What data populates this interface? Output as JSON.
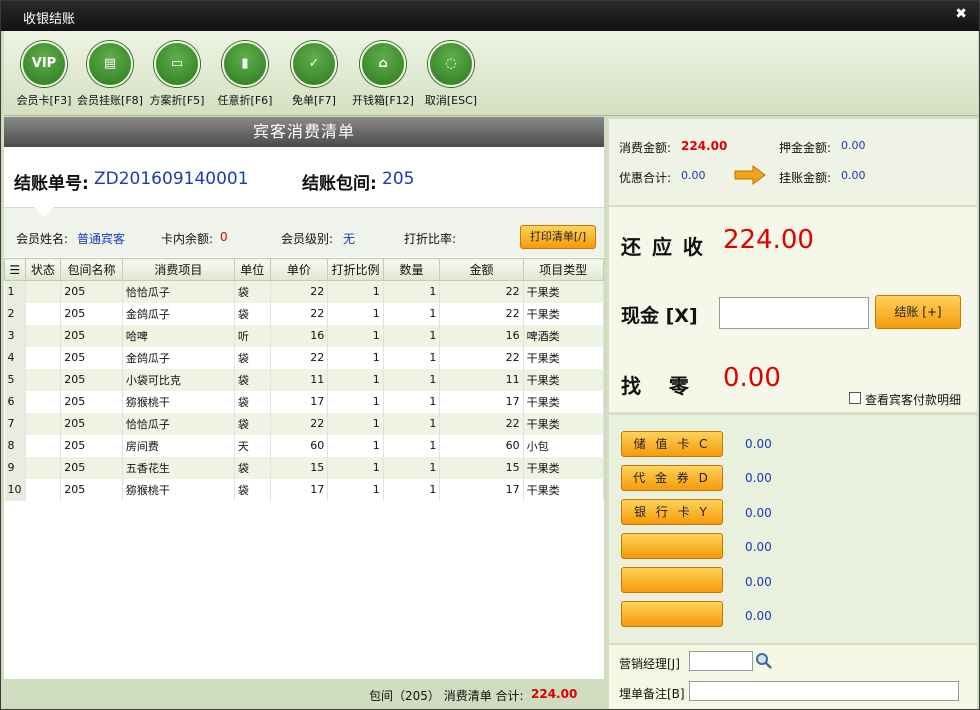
{
  "window": {
    "title": "收银结账",
    "close_glyph": "✖"
  },
  "toolbar": [
    {
      "label": "会员卡[F3]",
      "icon": "vip-icon",
      "glyph": "VIP"
    },
    {
      "label": "会员挂账[F8]",
      "icon": "bill-icon",
      "glyph": "▤"
    },
    {
      "label": "方案折[F5]",
      "icon": "plan-icon",
      "glyph": "▭"
    },
    {
      "label": "任意折[F6]",
      "icon": "discount-icon",
      "glyph": "▮"
    },
    {
      "label": "免单[F7]",
      "icon": "clipboard-check-icon",
      "glyph": "✓"
    },
    {
      "label": "开钱箱[F12]",
      "icon": "cashbox-icon",
      "glyph": "⌂"
    },
    {
      "label": "取消[ESC]",
      "icon": "cancel-icon",
      "glyph": "◌"
    }
  ],
  "list": {
    "title": "宾客消费清单",
    "order_no_label": "结账单号:",
    "order_no": "ZD201609140001",
    "room_label": "结账包间:",
    "room": "205"
  },
  "member": {
    "name_label": "会员姓名:",
    "name": "普通宾客",
    "balance_label": "卡内余额:",
    "balance": "0",
    "level_label": "会员级别:",
    "level": "无",
    "rate_label": "打折比率:",
    "rate": "",
    "print_button": "打印清单[/]"
  },
  "table": {
    "columns": [
      "状态",
      "包间名称",
      "消费项目",
      "单位",
      "单价",
      "打折比例",
      "数量",
      "金额",
      "项目类型"
    ],
    "rows": [
      {
        "idx": "1",
        "status": "",
        "room": "205",
        "item": "恰恰瓜子",
        "unit": "袋",
        "price": "22",
        "discount": "1",
        "qty": "1",
        "amount": "22",
        "type": "干果类"
      },
      {
        "idx": "2",
        "status": "",
        "room": "205",
        "item": "金鸽瓜子",
        "unit": "袋",
        "price": "22",
        "discount": "1",
        "qty": "1",
        "amount": "22",
        "type": "干果类"
      },
      {
        "idx": "3",
        "status": "",
        "room": "205",
        "item": "哈啤",
        "unit": "听",
        "price": "16",
        "discount": "1",
        "qty": "1",
        "amount": "16",
        "type": "啤酒类"
      },
      {
        "idx": "4",
        "status": "",
        "room": "205",
        "item": "金鸽瓜子",
        "unit": "袋",
        "price": "22",
        "discount": "1",
        "qty": "1",
        "amount": "22",
        "type": "干果类"
      },
      {
        "idx": "5",
        "status": "",
        "room": "205",
        "item": "小袋可比克",
        "unit": "袋",
        "price": "11",
        "discount": "1",
        "qty": "1",
        "amount": "11",
        "type": "干果类"
      },
      {
        "idx": "6",
        "status": "",
        "room": "205",
        "item": "猕猴桃干",
        "unit": "袋",
        "price": "17",
        "discount": "1",
        "qty": "1",
        "amount": "17",
        "type": "干果类"
      },
      {
        "idx": "7",
        "status": "",
        "room": "205",
        "item": "恰恰瓜子",
        "unit": "袋",
        "price": "22",
        "discount": "1",
        "qty": "1",
        "amount": "22",
        "type": "干果类"
      },
      {
        "idx": "8",
        "status": "",
        "room": "205",
        "item": "房间费",
        "unit": "天",
        "price": "60",
        "discount": "1",
        "qty": "1",
        "amount": "60",
        "type": "小包"
      },
      {
        "idx": "9",
        "status": "",
        "room": "205",
        "item": "五香花生",
        "unit": "袋",
        "price": "15",
        "discount": "1",
        "qty": "1",
        "amount": "15",
        "type": "干果类"
      },
      {
        "idx": "10",
        "status": "",
        "room": "205",
        "item": "猕猴桃干",
        "unit": "袋",
        "price": "17",
        "discount": "1",
        "qty": "1",
        "amount": "17",
        "type": "干果类"
      }
    ]
  },
  "footer": {
    "text": "包间（205） 消费清单 合计:",
    "total": "224.00"
  },
  "summary": {
    "consume_label": "消费金额:",
    "consume": "224.00",
    "deposit_label": "押金金额:",
    "deposit": "0.00",
    "discount_label": "优惠合计:",
    "discount": "0.00",
    "credit_label": "挂账金额:",
    "credit": "0.00"
  },
  "payment": {
    "due_label": "还 应 收",
    "due": "224.00",
    "cash_label": "现金 [X]",
    "cash_value": "",
    "checkout_button": "结账 [+]",
    "change_label": "找    零",
    "change": "0.00",
    "detail_checkbox": "查看宾客付款明细",
    "detail_checked": false
  },
  "methods": [
    {
      "label": "储 值 卡 C",
      "value": "0.00"
    },
    {
      "label": "代 金 券 D",
      "value": "0.00"
    },
    {
      "label": "银 行 卡 Y",
      "value": "0.00"
    },
    {
      "label": "",
      "value": "0.00"
    },
    {
      "label": "",
      "value": "0.00"
    },
    {
      "label": "",
      "value": "0.00"
    }
  ],
  "bottom": {
    "manager_label": "营销经理[J]",
    "manager_value": "",
    "remark_label": "埋单备注[B]",
    "remark_value": ""
  },
  "colors": {
    "accent_red": "#e00000",
    "value_blue": "#1a3ab8",
    "button_orange": "#f59a0a"
  }
}
